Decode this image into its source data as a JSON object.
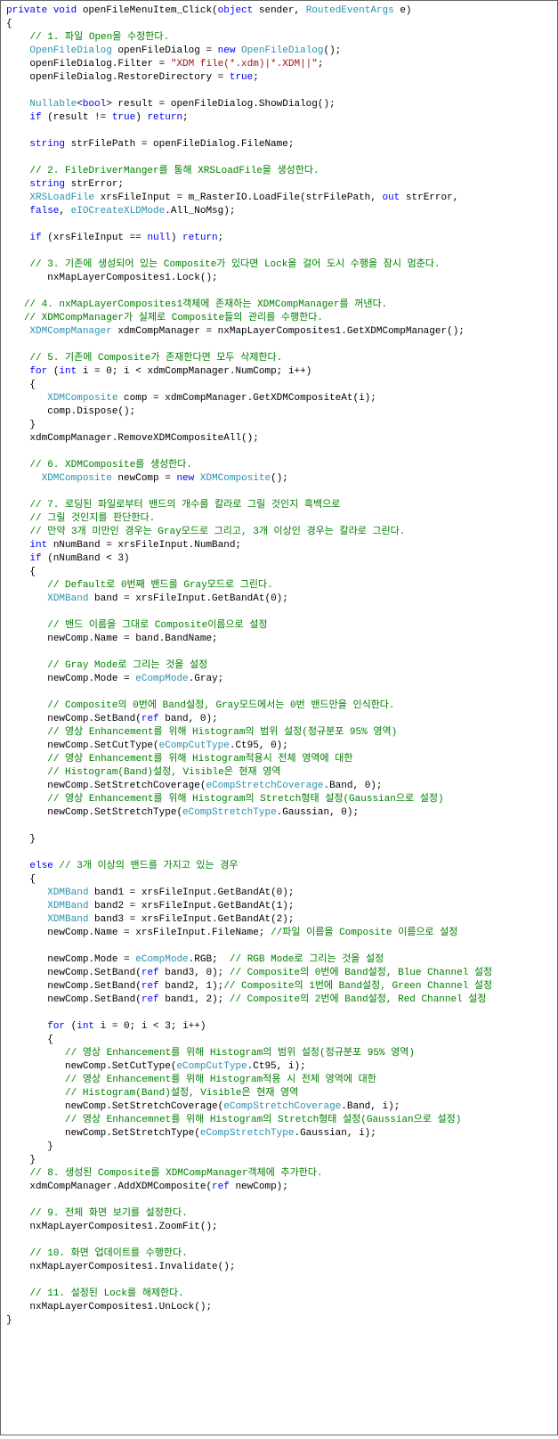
{
  "code": {
    "tokens": [
      {
        "t": "kw",
        "v": "private"
      },
      {
        "t": "tx",
        "v": " "
      },
      {
        "t": "kw",
        "v": "void"
      },
      {
        "t": "tx",
        "v": " openFileMenuItem_Click("
      },
      {
        "t": "kw",
        "v": "object"
      },
      {
        "t": "tx",
        "v": " sender, "
      },
      {
        "t": "typ",
        "v": "RoutedEventArgs"
      },
      {
        "t": "tx",
        "v": " e)\n{\n    "
      },
      {
        "t": "cmt",
        "v": "// 1. 파일 Open을 수정한다."
      },
      {
        "t": "tx",
        "v": "\n    "
      },
      {
        "t": "typ",
        "v": "OpenFileDialog"
      },
      {
        "t": "tx",
        "v": " openFileDialog = "
      },
      {
        "t": "kw",
        "v": "new"
      },
      {
        "t": "tx",
        "v": " "
      },
      {
        "t": "typ",
        "v": "OpenFileDialog"
      },
      {
        "t": "tx",
        "v": "();\n    openFileDialog.Filter = "
      },
      {
        "t": "str",
        "v": "\"XDM file(*.xdm)|*.XDM||\""
      },
      {
        "t": "tx",
        "v": ";\n    openFileDialog.RestoreDirectory = "
      },
      {
        "t": "kw",
        "v": "true"
      },
      {
        "t": "tx",
        "v": ";\n\n    "
      },
      {
        "t": "typ",
        "v": "Nullable"
      },
      {
        "t": "tx",
        "v": "<"
      },
      {
        "t": "kw",
        "v": "bool"
      },
      {
        "t": "tx",
        "v": "> result = openFileDialog.ShowDialog();\n    "
      },
      {
        "t": "kw",
        "v": "if"
      },
      {
        "t": "tx",
        "v": " (result != "
      },
      {
        "t": "kw",
        "v": "true"
      },
      {
        "t": "tx",
        "v": ") "
      },
      {
        "t": "kw",
        "v": "return"
      },
      {
        "t": "tx",
        "v": ";\n\n    "
      },
      {
        "t": "kw",
        "v": "string"
      },
      {
        "t": "tx",
        "v": " strFilePath = openFileDialog.FileName;\n\n    "
      },
      {
        "t": "cmt",
        "v": "// 2. FileDriverManger를 통해 XRSLoadFile을 생성한다."
      },
      {
        "t": "tx",
        "v": "\n    "
      },
      {
        "t": "kw",
        "v": "string"
      },
      {
        "t": "tx",
        "v": " strError;\n    "
      },
      {
        "t": "typ",
        "v": "XRSLoadFile"
      },
      {
        "t": "tx",
        "v": " xrsFileInput = m_RasterIO.LoadFile(strFilePath, "
      },
      {
        "t": "kw",
        "v": "out"
      },
      {
        "t": "tx",
        "v": " strError,\n    "
      },
      {
        "t": "kw",
        "v": "false"
      },
      {
        "t": "tx",
        "v": ", "
      },
      {
        "t": "typ",
        "v": "eIOCreateXLDMode"
      },
      {
        "t": "tx",
        "v": ".All_NoMsg);\n\n    "
      },
      {
        "t": "kw",
        "v": "if"
      },
      {
        "t": "tx",
        "v": " (xrsFileInput == "
      },
      {
        "t": "kw",
        "v": "null"
      },
      {
        "t": "tx",
        "v": ") "
      },
      {
        "t": "kw",
        "v": "return"
      },
      {
        "t": "tx",
        "v": ";\n\n    "
      },
      {
        "t": "cmt",
        "v": "// 3. 기존에 생성되어 있는 Composite가 있다면 Lock을 걸어 도시 수행을 잠시 멈춘다."
      },
      {
        "t": "tx",
        "v": "\n       nxMapLayerComposites1.Lock();\n\n   "
      },
      {
        "t": "cmt",
        "v": "// 4. nxMapLayerComposites1객체에 존재하는 XDMCompManager를 꺼낸다."
      },
      {
        "t": "tx",
        "v": "\n   "
      },
      {
        "t": "cmt",
        "v": "// XDMCompManager가 실제로 Composite들의 관리를 수행한다."
      },
      {
        "t": "tx",
        "v": "\n    "
      },
      {
        "t": "typ",
        "v": "XDMCompManager"
      },
      {
        "t": "tx",
        "v": " xdmCompManager = nxMapLayerComposites1.GetXDMCompManager();\n\n    "
      },
      {
        "t": "cmt",
        "v": "// 5. 기존에 Composite가 존재한다면 모두 삭제한다."
      },
      {
        "t": "tx",
        "v": "\n    "
      },
      {
        "t": "kw",
        "v": "for"
      },
      {
        "t": "tx",
        "v": " ("
      },
      {
        "t": "kw",
        "v": "int"
      },
      {
        "t": "tx",
        "v": " i = 0; i < xdmCompManager.NumComp; i++)\n    {\n       "
      },
      {
        "t": "typ",
        "v": "XDMComposite"
      },
      {
        "t": "tx",
        "v": " comp = xdmCompManager.GetXDMCompositeAt(i);\n       comp.Dispose();\n    }\n    xdmCompManager.RemoveXDMCompositeAll();\n\n    "
      },
      {
        "t": "cmt",
        "v": "// 6. XDMComposite를 생성한다."
      },
      {
        "t": "tx",
        "v": "\n      "
      },
      {
        "t": "typ",
        "v": "XDMComposite"
      },
      {
        "t": "tx",
        "v": " newComp = "
      },
      {
        "t": "kw",
        "v": "new"
      },
      {
        "t": "tx",
        "v": " "
      },
      {
        "t": "typ",
        "v": "XDMComposite"
      },
      {
        "t": "tx",
        "v": "();\n\n    "
      },
      {
        "t": "cmt",
        "v": "// 7. 로딩된 파일로부터 밴드의 개수를 칼라로 그릴 것인지 흑백으로"
      },
      {
        "t": "tx",
        "v": "\n    "
      },
      {
        "t": "cmt",
        "v": "// 그릴 것인지를 판단한다."
      },
      {
        "t": "tx",
        "v": "\n    "
      },
      {
        "t": "cmt",
        "v": "// 만약 3개 미만인 경우는 Gray모드로 그리고, 3개 이상인 경우는 칼라로 그린다."
      },
      {
        "t": "tx",
        "v": "\n    "
      },
      {
        "t": "kw",
        "v": "int"
      },
      {
        "t": "tx",
        "v": " nNumBand = xrsFileInput.NumBand;\n    "
      },
      {
        "t": "kw",
        "v": "if"
      },
      {
        "t": "tx",
        "v": " (nNumBand < 3)\n    {\n       "
      },
      {
        "t": "cmt",
        "v": "// Default로 0번째 밴드를 Gray모드로 그린다."
      },
      {
        "t": "tx",
        "v": "\n       "
      },
      {
        "t": "typ",
        "v": "XDMBand"
      },
      {
        "t": "tx",
        "v": " band = xrsFileInput.GetBandAt(0);\n\n       "
      },
      {
        "t": "cmt",
        "v": "// 밴드 이름을 그대로 Composite이름으로 설정"
      },
      {
        "t": "tx",
        "v": "\n       newComp.Name = band.BandName;\n\n       "
      },
      {
        "t": "cmt",
        "v": "// Gray Mode로 그리는 것을 설정"
      },
      {
        "t": "tx",
        "v": "\n       newComp.Mode = "
      },
      {
        "t": "typ",
        "v": "eCompMode"
      },
      {
        "t": "tx",
        "v": ".Gray;\n\n       "
      },
      {
        "t": "cmt",
        "v": "// Composite의 0번에 Band설정, Gray모드에서는 0번 밴드만을 인식한다."
      },
      {
        "t": "tx",
        "v": "\n       newComp.SetBand("
      },
      {
        "t": "kw",
        "v": "ref"
      },
      {
        "t": "tx",
        "v": " band, 0);\n       "
      },
      {
        "t": "cmt",
        "v": "// 영상 Enhancement를 위해 Histogram의 범위 설정(정규분포 95% 영역)"
      },
      {
        "t": "tx",
        "v": "\n       newComp.SetCutType("
      },
      {
        "t": "typ",
        "v": "eCompCutType"
      },
      {
        "t": "tx",
        "v": ".Ct95, 0);\n       "
      },
      {
        "t": "cmt",
        "v": "// 영상 Enhancement를 위해 Histogram적용시 전체 영역에 대한"
      },
      {
        "t": "tx",
        "v": "\n       "
      },
      {
        "t": "cmt",
        "v": "// Histogram(Band)설정, Visible은 현재 영역"
      },
      {
        "t": "tx",
        "v": "\n       newComp.SetStretchCoverage("
      },
      {
        "t": "typ",
        "v": "eCompStretchCoverage"
      },
      {
        "t": "tx",
        "v": ".Band, 0);\n       "
      },
      {
        "t": "cmt",
        "v": "// 영상 Enhancement를 위해 Histogram의 Stretch형태 설정(Gaussian으로 설정)"
      },
      {
        "t": "tx",
        "v": "\n       newComp.SetStretchType("
      },
      {
        "t": "typ",
        "v": "eCompStretchType"
      },
      {
        "t": "tx",
        "v": ".Gaussian, 0);\n\n    }\n\n    "
      },
      {
        "t": "kw",
        "v": "else"
      },
      {
        "t": "tx",
        "v": " "
      },
      {
        "t": "cmt",
        "v": "// 3개 이상의 밴드를 가지고 있는 경우"
      },
      {
        "t": "tx",
        "v": "\n    {\n       "
      },
      {
        "t": "typ",
        "v": "XDMBand"
      },
      {
        "t": "tx",
        "v": " band1 = xrsFileInput.GetBandAt(0);\n       "
      },
      {
        "t": "typ",
        "v": "XDMBand"
      },
      {
        "t": "tx",
        "v": " band2 = xrsFileInput.GetBandAt(1);\n       "
      },
      {
        "t": "typ",
        "v": "XDMBand"
      },
      {
        "t": "tx",
        "v": " band3 = xrsFileInput.GetBandAt(2);\n       newComp.Name = xrsFileInput.FileName; "
      },
      {
        "t": "cmt",
        "v": "//파일 이름을 Composite 이름으로 설정"
      },
      {
        "t": "tx",
        "v": "\n\n       newComp.Mode = "
      },
      {
        "t": "typ",
        "v": "eCompMode"
      },
      {
        "t": "tx",
        "v": ".RGB;  "
      },
      {
        "t": "cmt",
        "v": "// RGB Mode로 그리는 것을 설정"
      },
      {
        "t": "tx",
        "v": "\n       newComp.SetBand("
      },
      {
        "t": "kw",
        "v": "ref"
      },
      {
        "t": "tx",
        "v": " band3, 0); "
      },
      {
        "t": "cmt",
        "v": "// Composite의 0번에 Band설정, Blue Channel 설정"
      },
      {
        "t": "tx",
        "v": "\n       newComp.SetBand("
      },
      {
        "t": "kw",
        "v": "ref"
      },
      {
        "t": "tx",
        "v": " band2, 1);"
      },
      {
        "t": "cmt",
        "v": "// Composite의 1번에 Band설정, Green Channel 설정"
      },
      {
        "t": "tx",
        "v": "\n       newComp.SetBand("
      },
      {
        "t": "kw",
        "v": "ref"
      },
      {
        "t": "tx",
        "v": " band1, 2); "
      },
      {
        "t": "cmt",
        "v": "// Composite의 2번에 Band설정, Red Channel 설정"
      },
      {
        "t": "tx",
        "v": "\n\n       "
      },
      {
        "t": "kw",
        "v": "for"
      },
      {
        "t": "tx",
        "v": " ("
      },
      {
        "t": "kw",
        "v": "int"
      },
      {
        "t": "tx",
        "v": " i = 0; i < 3; i++)\n       {\n          "
      },
      {
        "t": "cmt",
        "v": "// 영상 Enhancement를 위해 Histogram의 범위 설정(정규분포 95% 영역)"
      },
      {
        "t": "tx",
        "v": "\n          newComp.SetCutType("
      },
      {
        "t": "typ",
        "v": "eCompCutType"
      },
      {
        "t": "tx",
        "v": ".Ct95, i);\n          "
      },
      {
        "t": "cmt",
        "v": "// 영상 Enhancement를 위해 Histogram적용 시 전체 영역에 대한"
      },
      {
        "t": "tx",
        "v": "\n          "
      },
      {
        "t": "cmt",
        "v": "// Histogram(Band)설정, Visible은 현재 영역"
      },
      {
        "t": "tx",
        "v": "\n          newComp.SetStretchCoverage("
      },
      {
        "t": "typ",
        "v": "eCompStretchCoverage"
      },
      {
        "t": "tx",
        "v": ".Band, i);\n          "
      },
      {
        "t": "cmt",
        "v": "// 영상 Enhancemnet를 위해 Histogram의 Stretch형태 설정(Gaussian으로 설정)"
      },
      {
        "t": "tx",
        "v": "\n          newComp.SetStretchType("
      },
      {
        "t": "typ",
        "v": "eCompStretchType"
      },
      {
        "t": "tx",
        "v": ".Gaussian, i);\n       }\n    }\n    "
      },
      {
        "t": "cmt",
        "v": "// 8. 생성된 Composite를 XDMCompManager객체에 추가한다."
      },
      {
        "t": "tx",
        "v": "\n    xdmCompManager.AddXDMComposite("
      },
      {
        "t": "kw",
        "v": "ref"
      },
      {
        "t": "tx",
        "v": " newComp);\n\n    "
      },
      {
        "t": "cmt",
        "v": "// 9. 전체 화면 보기를 설정한다."
      },
      {
        "t": "tx",
        "v": "\n    nxMapLayerComposites1.ZoomFit();\n\n    "
      },
      {
        "t": "cmt",
        "v": "// 10. 화면 업데이트를 수행한다."
      },
      {
        "t": "tx",
        "v": "\n    nxMapLayerComposites1.Invalidate();\n\n    "
      },
      {
        "t": "cmt",
        "v": "// 11. 설정된 Lock를 해제한다."
      },
      {
        "t": "tx",
        "v": "\n    nxMapLayerComposites1.UnLock();\n}\n"
      }
    ]
  }
}
